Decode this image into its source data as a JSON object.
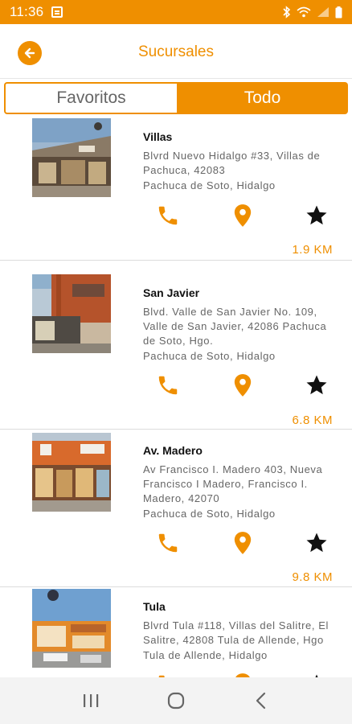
{
  "status_bar": {
    "time": "11:36",
    "icons": [
      "notification-icon",
      "bluetooth-icon",
      "wifi-icon",
      "signal-icon",
      "battery-icon"
    ]
  },
  "header": {
    "title": "Sucursales",
    "back_icon": "arrow-left-icon"
  },
  "tabs": [
    {
      "label": "Favoritos",
      "selected": false
    },
    {
      "label": "Todo",
      "selected": true
    }
  ],
  "branches": [
    {
      "name": "Villas",
      "address": "Blvrd Nuevo Hidalgo #33, Villas de Pachuca, 42083",
      "city": "Pachuca de Soto, Hidalgo",
      "distance": "1.9 KM"
    },
    {
      "name": "San Javier",
      "address": "Blvd. Valle de San Javier No. 109, Valle de San Javier, 42086 Pachuca de Soto, Hgo.",
      "city": "Pachuca de Soto, Hidalgo",
      "distance": "6.8 KM"
    },
    {
      "name": "Av. Madero",
      "address": "Av Francisco I. Madero 403, Nueva Francisco I Madero, Francisco I. Madero, 42070",
      "city": "Pachuca de Soto, Hidalgo",
      "distance": "9.8 KM"
    },
    {
      "name": "Tula",
      "address": "Blvrd Tula #118, Villas del Salitre, El Salitre, 42808 Tula de Allende, Hgo",
      "city": "Tula de Allende, Hidalgo",
      "distance": ""
    }
  ],
  "actions": {
    "call_icon": "phone-icon",
    "map_icon": "map-pin-icon",
    "favorite_icon": "star-icon"
  },
  "colors": {
    "accent": "#ef8f00",
    "text": "#666666",
    "star": "#111111"
  },
  "nav": [
    "recent-apps-icon",
    "home-icon",
    "back-icon"
  ]
}
